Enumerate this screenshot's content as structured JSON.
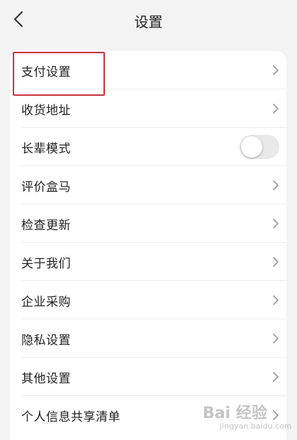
{
  "header": {
    "title": "设置",
    "back_icon": "chevron-left-icon"
  },
  "menu": {
    "items": [
      {
        "label": "支付设置",
        "control": "chevron",
        "highlighted": true
      },
      {
        "label": "收货地址",
        "control": "chevron"
      },
      {
        "label": "长辈模式",
        "control": "toggle",
        "toggle_on": false
      },
      {
        "label": "评价盒马",
        "control": "chevron"
      },
      {
        "label": "检查更新",
        "control": "chevron"
      },
      {
        "label": "关于我们",
        "control": "chevron"
      },
      {
        "label": "企业采购",
        "control": "chevron"
      },
      {
        "label": "隐私设置",
        "control": "chevron"
      },
      {
        "label": "其他设置",
        "control": "chevron"
      },
      {
        "label": "个人信息共享清单",
        "control": "chevron"
      }
    ]
  },
  "watermark": {
    "main": "Bai 经验",
    "sub": "jingyan.baidu.com"
  },
  "colors": {
    "background": "#f3f3f3",
    "card": "#ffffff",
    "highlight_border": "#c9343c",
    "chevron": "#9a9a9a",
    "toggle_off": "#e9e9e9"
  }
}
